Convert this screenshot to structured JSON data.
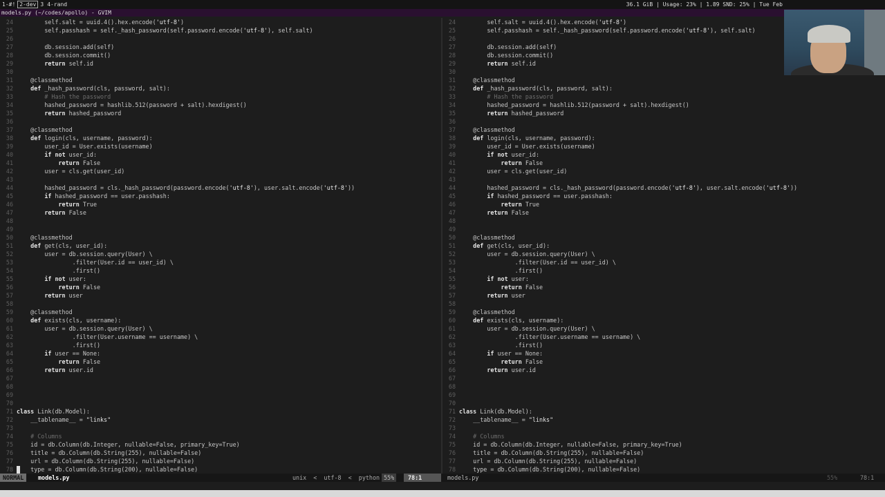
{
  "topbar": {
    "workspaces": [
      {
        "label": "1-#!",
        "active": false
      },
      {
        "label": "2-dev",
        "active": true
      },
      {
        "label": "3",
        "active": false
      },
      {
        "label": "4-rand",
        "active": false
      }
    ],
    "status": "36.1 GiB | Usage:  23% | 1.89  SND:  25% | Tue Feb"
  },
  "window": {
    "title": "models.py (~/codes/apollo) - GVIM"
  },
  "editor": {
    "lines": [
      {
        "n": "24",
        "t": "        self.salt = uuid.uuid4().hex.encode('utf-8')"
      },
      {
        "n": "25",
        "t": "        self.passhash = self._hash_password(self.password.encode('utf-8'), self.salt)"
      },
      {
        "n": "26",
        "t": ""
      },
      {
        "n": "27",
        "t": "        db.session.add(self)"
      },
      {
        "n": "28",
        "t": "        db.session.commit()"
      },
      {
        "n": "29",
        "t": "        return self.id"
      },
      {
        "n": "30",
        "t": ""
      },
      {
        "n": "31",
        "t": "    @classmethod"
      },
      {
        "n": "32",
        "t": "    def _hash_password(cls, password, salt):"
      },
      {
        "n": "33",
        "t": "        # Hash the password"
      },
      {
        "n": "34",
        "t": "        hashed_password = hashlib.sha512(password + salt).hexdigest()"
      },
      {
        "n": "35",
        "t": "        return hashed_password"
      },
      {
        "n": "36",
        "t": ""
      },
      {
        "n": "37",
        "t": "    @classmethod"
      },
      {
        "n": "38",
        "t": "    def login(cls, username, password):"
      },
      {
        "n": "39",
        "t": "        user_id = User.exists(username)"
      },
      {
        "n": "40",
        "t": "        if not user_id:"
      },
      {
        "n": "41",
        "t": "            return False"
      },
      {
        "n": "42",
        "t": "        user = cls.get(user_id)"
      },
      {
        "n": "43",
        "t": ""
      },
      {
        "n": "44",
        "t": "        hashed_password = cls._hash_password(password.encode('utf-8'), user.salt.encode('utf-8'))"
      },
      {
        "n": "45",
        "t": "        if hashed_password == user.passhash:"
      },
      {
        "n": "46",
        "t": "            return True"
      },
      {
        "n": "47",
        "t": "        return False"
      },
      {
        "n": "48",
        "t": ""
      },
      {
        "n": "49",
        "t": ""
      },
      {
        "n": "50",
        "t": "    @classmethod"
      },
      {
        "n": "51",
        "t": "    def get(cls, user_id):"
      },
      {
        "n": "52",
        "t": "        user = db.session.query(User) \\"
      },
      {
        "n": "53",
        "t": "                .filter(User.id == user_id) \\"
      },
      {
        "n": "54",
        "t": "                .first()"
      },
      {
        "n": "55",
        "t": "        if not user:"
      },
      {
        "n": "56",
        "t": "            return False"
      },
      {
        "n": "57",
        "t": "        return user"
      },
      {
        "n": "58",
        "t": ""
      },
      {
        "n": "59",
        "t": "    @classmethod"
      },
      {
        "n": "60",
        "t": "    def exists(cls, username):"
      },
      {
        "n": "61",
        "t": "        user = db.session.query(User) \\"
      },
      {
        "n": "62",
        "t": "                .filter(User.username == username) \\"
      },
      {
        "n": "63",
        "t": "                .first()"
      },
      {
        "n": "64",
        "t": "        if user == None:"
      },
      {
        "n": "65",
        "t": "            return False"
      },
      {
        "n": "66",
        "t": "        return user.id"
      },
      {
        "n": "67",
        "t": ""
      },
      {
        "n": "68",
        "t": ""
      },
      {
        "n": "69",
        "t": ""
      },
      {
        "n": "70",
        "t": ""
      },
      {
        "n": "71",
        "t": "class Link(db.Model):"
      },
      {
        "n": "72",
        "t": "    __tablename__ = \"links\""
      },
      {
        "n": "73",
        "t": ""
      },
      {
        "n": "74",
        "t": "    # Columns"
      },
      {
        "n": "75",
        "t": "    id = db.Column(db.Integer, nullable=False, primary_key=True)"
      },
      {
        "n": "76",
        "t": "    title = db.Column(db.String(255), nullable=False)"
      },
      {
        "n": "77",
        "t": "    url = db.Column(db.String(255), nullable=False)"
      },
      {
        "n": "78",
        "t": "    type = db.Column(db.String(200), nullable=False)"
      }
    ]
  },
  "statusline": {
    "mode": "NORMAL",
    "filename": "models.py",
    "format_info": "unix  <  utf-8  <  python",
    "percent": "55%",
    "position": "78:1",
    "right_filename": "models.py",
    "right_percent": "55%",
    "right_position": "78:1"
  }
}
